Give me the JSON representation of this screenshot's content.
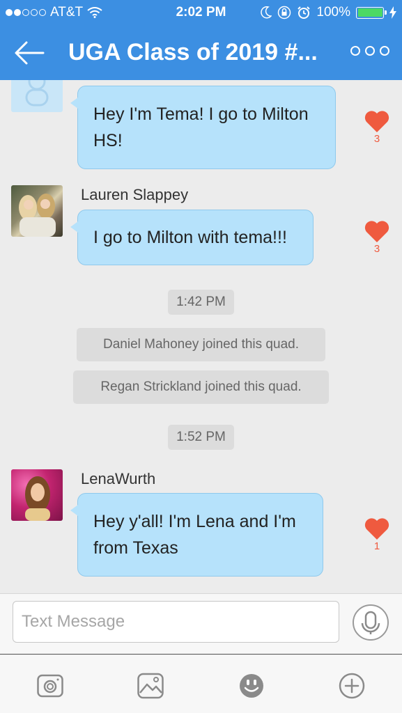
{
  "status_bar": {
    "carrier": "AT&T",
    "time": "2:02 PM",
    "battery": "100%",
    "battery_color": "#4cd964"
  },
  "header": {
    "title": "UGA Class of 2019 #...",
    "back_icon": "back-arrow-icon",
    "more_icon": "more-options-icon",
    "accent_color": "#3c8fe2"
  },
  "messages": [
    {
      "sender": "",
      "text_lines": [
        "Hey I'm Tema! I go to Milton",
        "HS!"
      ],
      "likes": "3"
    },
    {
      "sender": "Lauren Slappey",
      "text_lines": [
        "I go to Milton with tema!!!"
      ],
      "likes": "3"
    },
    {
      "sender": "LenaWurth",
      "text_lines": [
        "Hey y'all! I'm Lena and I'm",
        "from Texas"
      ],
      "likes": "1"
    }
  ],
  "system": {
    "time1": "1:42 PM",
    "joined1": "Daniel Mahoney joined this quad.",
    "joined2": "Regan Strickland joined this quad.",
    "time2": "1:52 PM"
  },
  "input": {
    "placeholder": "Text Message",
    "mic_icon": "microphone-icon"
  },
  "toolbar": {
    "icons": [
      "camera-icon",
      "photo-icon",
      "emoji-icon",
      "plus-icon"
    ]
  },
  "colors": {
    "bubble": "#b6e2fb",
    "heart": "#ef5a3f"
  }
}
